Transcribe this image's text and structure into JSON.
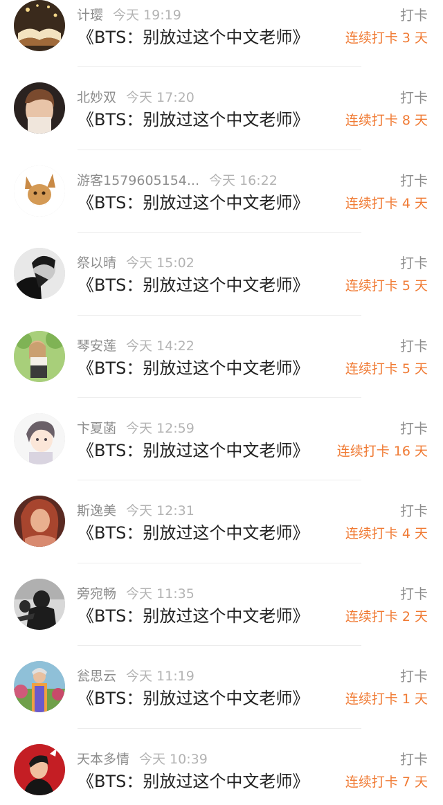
{
  "accent_color": "#f07a33",
  "entries": [
    {
      "name": "计璎",
      "time": "今天 19:19",
      "title": "《BTS：别放过这个中文老师》",
      "checkin": "打卡",
      "streak": "连续打卡 3 天",
      "avatar": "book-avatar"
    },
    {
      "name": "北妙双",
      "time": "今天 17:20",
      "title": "《BTS：别放过这个中文老师》",
      "checkin": "打卡",
      "streak": "连续打卡 8 天",
      "avatar": "person-avatar"
    },
    {
      "name": "游客1579605154...",
      "time": "今天 16:22",
      "title": "《BTS：别放过这个中文老师》",
      "checkin": "打卡",
      "streak": "连续打卡 4 天",
      "avatar": "eevee-avatar"
    },
    {
      "name": "祭以晴",
      "time": "今天 15:02",
      "title": "《BTS：别放过这个中文老师》",
      "checkin": "打卡",
      "streak": "连续打卡 5 天",
      "avatar": "bw-person-avatar"
    },
    {
      "name": "琴安莲",
      "time": "今天 14:22",
      "title": "《BTS：别放过这个中文老师》",
      "checkin": "打卡",
      "streak": "连续打卡 5 天",
      "avatar": "illustration-avatar"
    },
    {
      "name": "卞夏菡",
      "time": "今天 12:59",
      "title": "《BTS：别放过这个中文老师》",
      "checkin": "打卡",
      "streak": "连续打卡 16 天",
      "avatar": "anime-avatar"
    },
    {
      "name": "斯逸美",
      "time": "今天 12:31",
      "title": "《BTS：别放过这个中文老师》",
      "checkin": "打卡",
      "streak": "连续打卡 4 天",
      "avatar": "woman-avatar"
    },
    {
      "name": "旁宛畅",
      "time": "今天 11:35",
      "title": "《BTS：别放过这个中文老师》",
      "checkin": "打卡",
      "streak": "连续打卡 2 天",
      "avatar": "soldier-avatar"
    },
    {
      "name": "瓮思云",
      "time": "今天 11:19",
      "title": "《BTS：别放过这个中文老师》",
      "checkin": "打卡",
      "streak": "连续打卡 1 天",
      "avatar": "outdoor-avatar"
    },
    {
      "name": "天本多情",
      "time": "今天 10:39",
      "title": "《BTS：别放过这个中文老师》",
      "checkin": "打卡",
      "streak": "连续打卡 7 天",
      "avatar": "red-person-avatar"
    }
  ]
}
